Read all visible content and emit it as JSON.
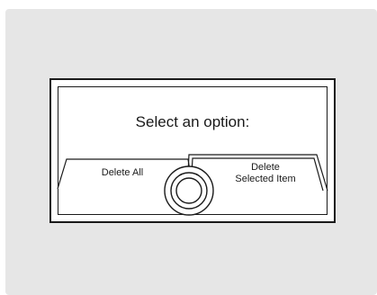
{
  "dialog": {
    "prompt": "Select an option:",
    "options": [
      {
        "label": "Delete All",
        "selected": false
      },
      {
        "label_line1": "Delete",
        "label_line2": "Selected Item",
        "selected": true
      }
    ]
  }
}
